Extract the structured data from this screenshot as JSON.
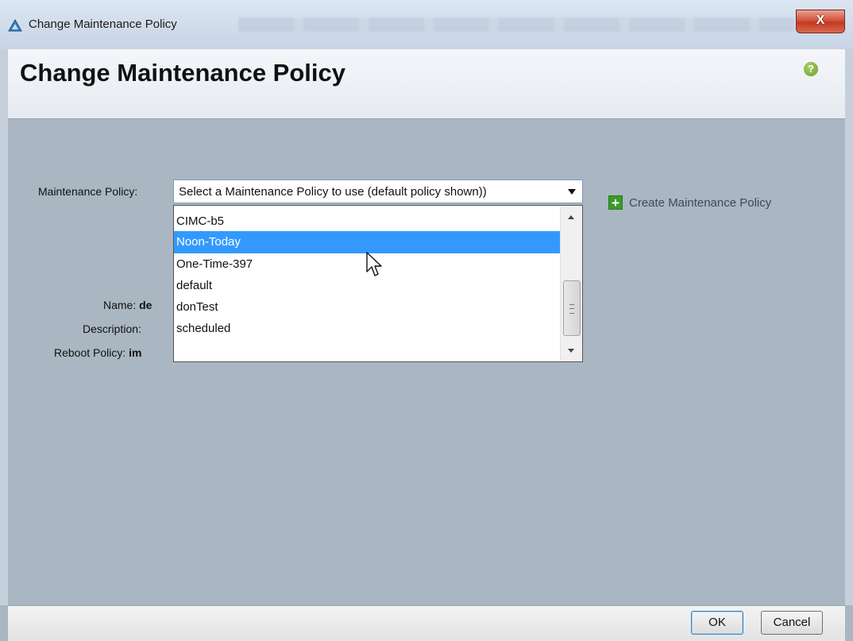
{
  "window": {
    "title": "Change Maintenance Policy",
    "close_label": "X"
  },
  "header": {
    "title": "Change Maintenance Policy",
    "help_label": "?"
  },
  "form": {
    "maintenance_policy_label": "Maintenance Policy:",
    "select_value": "Select a Maintenance Policy to use (default policy shown))",
    "options": [
      "CIMC-b5",
      "Noon-Today",
      "One-Time-397",
      "default",
      "donTest",
      "scheduled"
    ],
    "highlighted_option": "Noon-Today",
    "name_label": "Name:",
    "name_value": "de",
    "description_label": "Description:",
    "reboot_policy_label": "Reboot Policy:",
    "reboot_policy_value": "im"
  },
  "create_link": {
    "label": "Create Maintenance Policy"
  },
  "footer": {
    "ok_label": "OK",
    "cancel_label": "Cancel"
  },
  "colors": {
    "highlight": "#3399ff",
    "background": "#aab6c2",
    "accent_green": "#3a9a2a"
  }
}
